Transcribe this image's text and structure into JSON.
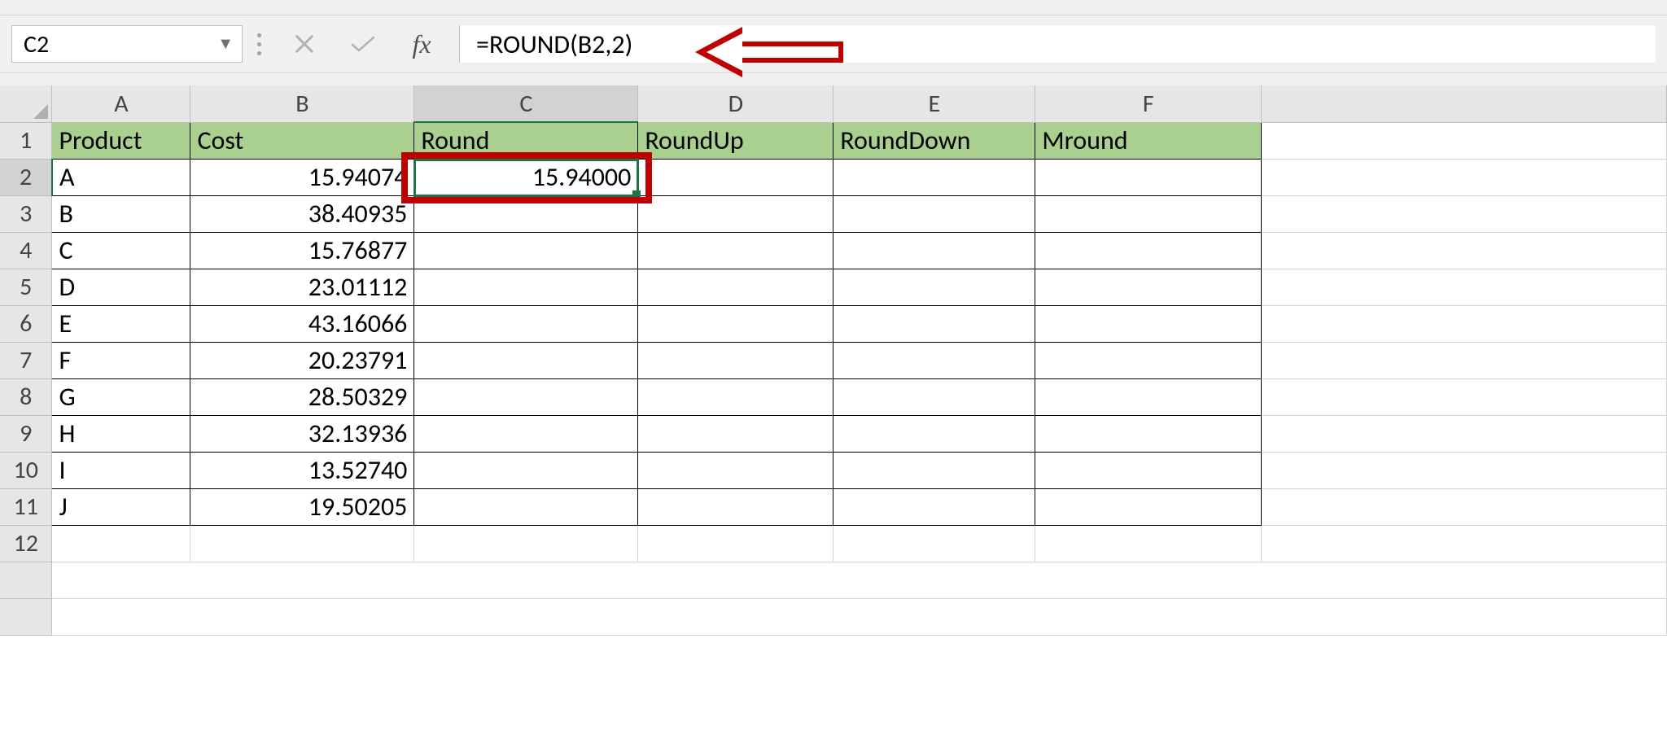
{
  "namebox": {
    "value": "C2"
  },
  "formula": "=ROUND(B2,2)",
  "fx_label": "fx",
  "columns": [
    "A",
    "B",
    "C",
    "D",
    "E",
    "F"
  ],
  "headers": {
    "A": "Product",
    "B": "Cost",
    "C": "Round",
    "D": "RoundUp",
    "E": "RoundDown",
    "F": "Mround"
  },
  "rows": [
    {
      "n": "2",
      "A": "A",
      "B": "15.94074",
      "C": "15.94000",
      "D": "",
      "E": "",
      "F": ""
    },
    {
      "n": "3",
      "A": "B",
      "B": "38.40935",
      "C": "",
      "D": "",
      "E": "",
      "F": ""
    },
    {
      "n": "4",
      "A": "C",
      "B": "15.76877",
      "C": "",
      "D": "",
      "E": "",
      "F": ""
    },
    {
      "n": "5",
      "A": "D",
      "B": "23.01112",
      "C": "",
      "D": "",
      "E": "",
      "F": ""
    },
    {
      "n": "6",
      "A": "E",
      "B": "43.16066",
      "C": "",
      "D": "",
      "E": "",
      "F": ""
    },
    {
      "n": "7",
      "A": "F",
      "B": "20.23791",
      "C": "",
      "D": "",
      "E": "",
      "F": ""
    },
    {
      "n": "8",
      "A": "G",
      "B": "28.50329",
      "C": "",
      "D": "",
      "E": "",
      "F": ""
    },
    {
      "n": "9",
      "A": "H",
      "B": "32.13936",
      "C": "",
      "D": "",
      "E": "",
      "F": ""
    },
    {
      "n": "10",
      "A": "I",
      "B": "13.52740",
      "C": "",
      "D": "",
      "E": "",
      "F": ""
    },
    {
      "n": "11",
      "A": "J",
      "B": "19.50205",
      "C": "",
      "D": "",
      "E": "",
      "F": ""
    }
  ],
  "extra_row": "12",
  "selected_cell": "C2",
  "annotation": {
    "arrow_color": "#c00000"
  }
}
